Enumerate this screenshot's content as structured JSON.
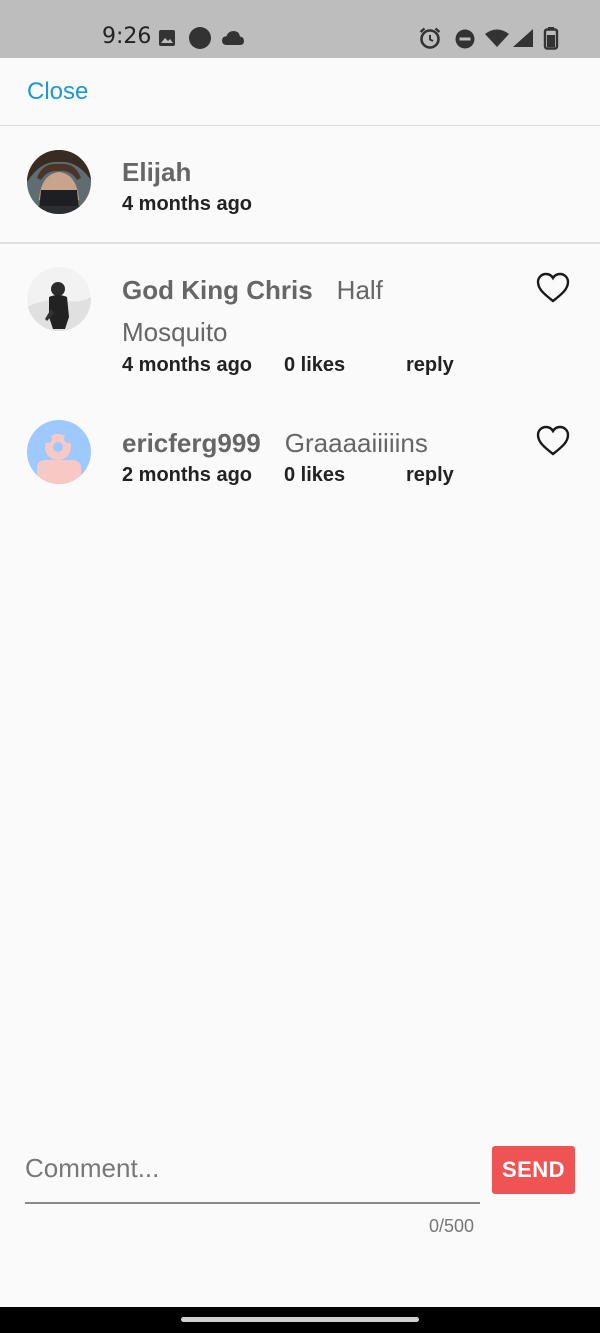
{
  "status_bar": {
    "time": "9:26",
    "icons": [
      "image-icon",
      "circle-icon",
      "cloud-icon",
      "alarm-icon",
      "dnd-icon",
      "wifi-icon",
      "cell-signal-icon",
      "battery-icon"
    ]
  },
  "header": {
    "close_label": "Close"
  },
  "post": {
    "author": "Elijah",
    "time": "4 months ago"
  },
  "comments": [
    {
      "user": "God King Chris",
      "text": "Half Mosquito",
      "time": "4 months ago",
      "likes": "0 likes",
      "reply": "reply"
    },
    {
      "user": "ericferg999",
      "text": "Graaaaiiiiins",
      "time": "2 months ago",
      "likes": "0 likes",
      "reply": "reply"
    }
  ],
  "composer": {
    "placeholder": "Comment...",
    "counter": "0/500",
    "send_label": "SEND"
  },
  "colors": {
    "accent": "#2196d3",
    "send": "#ef5354",
    "status_bar": "#bdbdbd"
  }
}
